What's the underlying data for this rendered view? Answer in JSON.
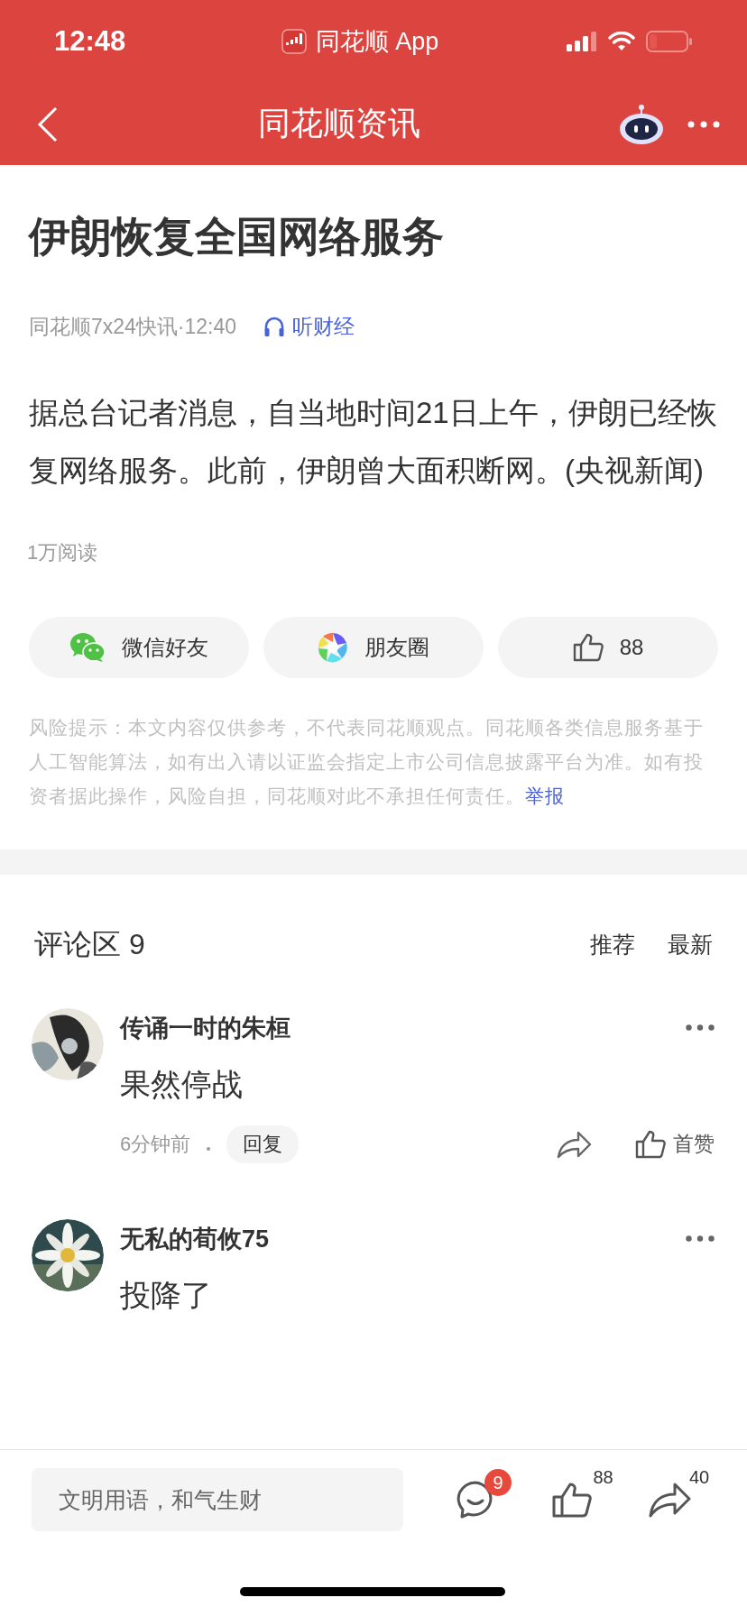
{
  "status_bar": {
    "time": "12:48",
    "app_label": "同花顺 App"
  },
  "nav": {
    "title": "同花顺资讯"
  },
  "article": {
    "title": "伊朗恢复全国网络服务",
    "source": "同花顺7x24快讯·12:40",
    "listen": "听财经",
    "body": "据总台记者消息，自当地时间21日上午，伊朗已经恢复网络服务。此前，伊朗曾大面积断网。(央视新闻)",
    "reads": "1万阅读"
  },
  "share_buttons": [
    {
      "kind": "wechat",
      "label": "微信好友"
    },
    {
      "kind": "moments",
      "label": "朋友圈"
    },
    {
      "kind": "like",
      "label": "88"
    }
  ],
  "risk_notice": {
    "text": "风险提示：本文内容仅供参考，不代表同花顺观点。同花顺各类信息服务基于人工智能算法，如有出入请以证监会指定上市公司信息披露平台为准。如有投资者据此操作，风险自担，同花顺对此不承担任何责任。",
    "report_link": "举报"
  },
  "comments_header": {
    "title": "评论区 9",
    "sort_tabs": [
      {
        "label": "推荐",
        "selected": false
      },
      {
        "label": "最新",
        "selected": false
      }
    ]
  },
  "comments": [
    {
      "author": "传诵一时的朱桓",
      "text": "果然停战",
      "time": "6分钟前",
      "reply_label": "回复",
      "like_label": "首赞"
    },
    {
      "author": "无私的荀攸75",
      "text": "投降了"
    }
  ],
  "bottom_bar": {
    "placeholder": "文明用语，和气生财",
    "comment_count": "9",
    "like_count": "88",
    "share_count": "40"
  }
}
